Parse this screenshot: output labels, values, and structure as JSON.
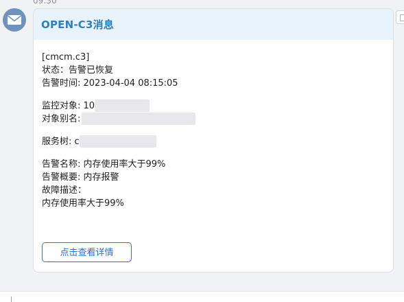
{
  "timestamp": "09:30",
  "avatar": {
    "icon": "envelope-icon",
    "color": "#6e93be"
  },
  "card": {
    "title": "OPEN-C3消息",
    "lines": {
      "tree_code": "[cmcm.c3]",
      "status": "状态：告警已恢复",
      "alert_time": "告警时间: 2023-04-04 08:15:05",
      "monitor_target": "监控对象: 10",
      "target_alias": "对象别名:",
      "service_tree": "服务树: c",
      "alert_name": "告警名称: 内存使用率大于99%",
      "alert_summary": "告警概要: 内存报警",
      "fault_desc": "故障描述：",
      "fault_detail": "内存使用率大于99%"
    },
    "detail_button": "点击查看详情"
  },
  "colors": {
    "header_bg": "#e9f3fb",
    "title": "#2c7fc4",
    "button_border": "#2f6fdc"
  }
}
